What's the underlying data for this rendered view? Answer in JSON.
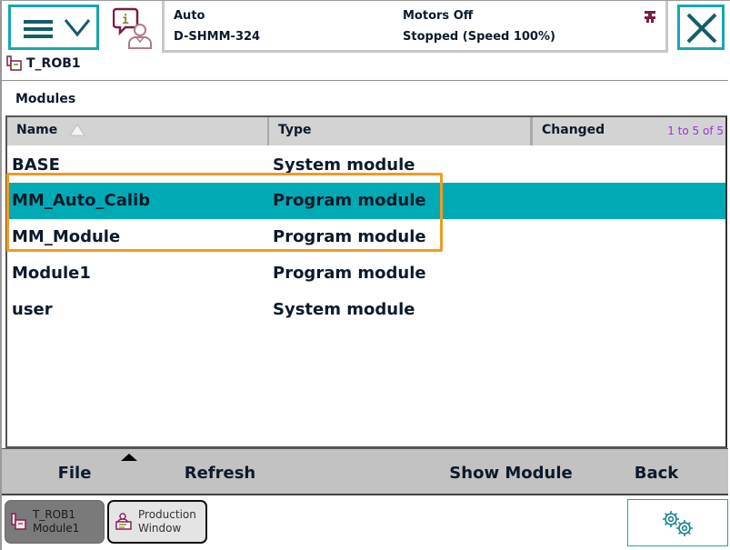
{
  "colors": {
    "accent": "#14a9b1",
    "selection": "#00aab5",
    "highlight_outline": "#f09b1f",
    "paging_text": "#9a35d6",
    "icon_maroon": "#7a1e45"
  },
  "header": {
    "menu_button": {
      "icon": "menu-hamburger-chevron-icon"
    },
    "info_icon": "event-log-user-icon",
    "status": {
      "mode": "Auto",
      "system_name": "D-SHMM-324",
      "motors": "Motors Off",
      "state": "Stopped (Speed 100%)",
      "speed_icon": "speed-icon"
    },
    "close_button": {
      "icon": "close-icon"
    }
  },
  "task": {
    "label": "T_ROB1",
    "icon": "robot-task-icon"
  },
  "modules": {
    "title": "Modules",
    "columns": [
      {
        "label": "Name",
        "sort": "ascending"
      },
      {
        "label": "Type"
      },
      {
        "label": "Changed"
      }
    ],
    "paging": "1 to 5 of 5",
    "rows": [
      {
        "name": "BASE",
        "type": "System module",
        "changed": "",
        "selected": false
      },
      {
        "name": "MM_Auto_Calib",
        "type": "Program module",
        "changed": "",
        "selected": true
      },
      {
        "name": "MM_Module",
        "type": "Program module",
        "changed": "",
        "selected": false
      },
      {
        "name": "Module1",
        "type": "Program module",
        "changed": "",
        "selected": false
      },
      {
        "name": "user",
        "type": "System module",
        "changed": "",
        "selected": false
      }
    ]
  },
  "toolbar": {
    "file_label": "File",
    "refresh_label": "Refresh",
    "show_module_label": "Show Module",
    "back_label": "Back"
  },
  "taskbar": {
    "tabs": [
      {
        "line1": "T_ROB1",
        "line2": "Module1",
        "active": true,
        "icon": "program-editor-icon"
      },
      {
        "line1": "Production",
        "line2": "Window",
        "active": false,
        "icon": "production-window-icon"
      }
    ],
    "settings_icon": "gears-icon"
  }
}
